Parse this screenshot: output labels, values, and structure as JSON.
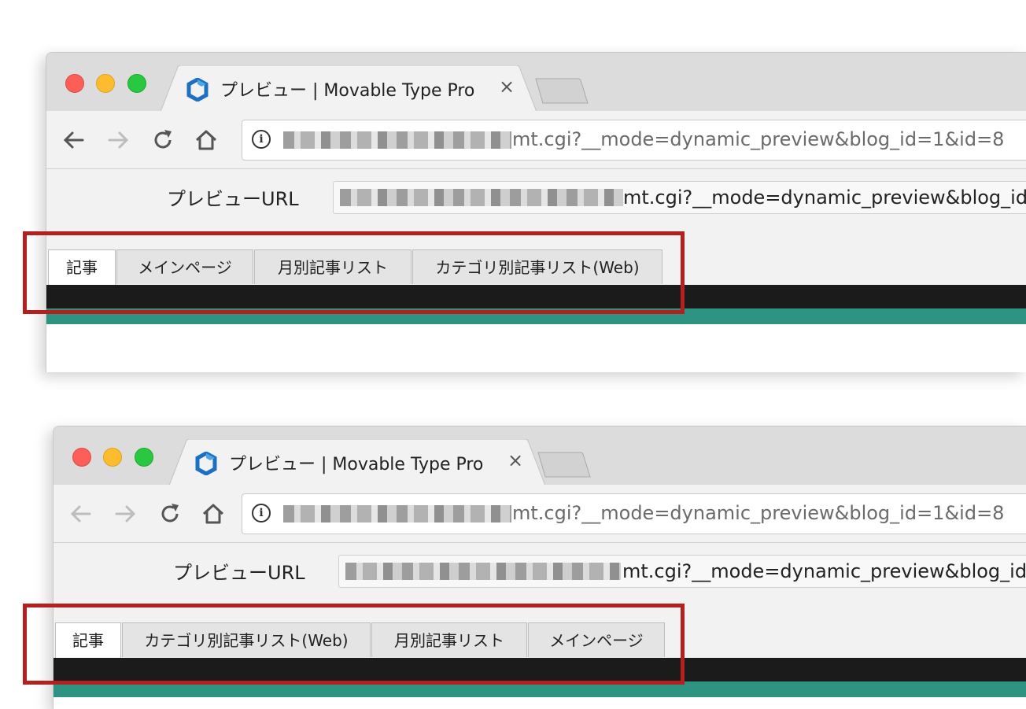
{
  "colors": {
    "highlight": "#b3201e",
    "teal": "#2f9382",
    "black_band": "#1b1b1b"
  },
  "screenshots": [
    {
      "tab_title": "プレビュー | Movable Type Pro",
      "tab_close": "×",
      "address_url": "mt.cgi?__mode=dynamic_preview&blog_id=1&id=8",
      "preview_label": "プレビューURL",
      "preview_url": "mt.cgi?__mode=dynamic_preview&blog_id",
      "back_enabled": true,
      "tabs": [
        "記事",
        "メインページ",
        "月別記事リスト",
        "カテゴリ別記事リスト(Web)"
      ]
    },
    {
      "tab_title": "プレビュー | Movable Type Pro",
      "tab_close": "×",
      "address_url": "mt.cgi?__mode=dynamic_preview&blog_id=1&id=8",
      "preview_label": "プレビューURL",
      "preview_url": "mt.cgi?__mode=dynamic_preview&blog_id",
      "back_enabled": false,
      "tabs": [
        "記事",
        "カテゴリ別記事リスト(Web)",
        "月別記事リスト",
        "メインページ"
      ]
    }
  ]
}
